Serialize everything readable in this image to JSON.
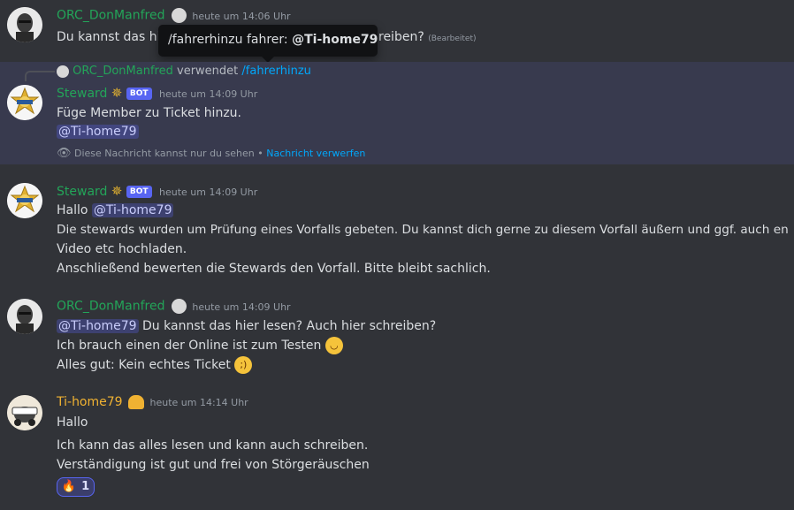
{
  "tooltip": {
    "command": "/fahrerhinzu fahrer:",
    "mention": "@Ti-home79"
  },
  "messages": {
    "m1": {
      "author": "ORC_DonManfred",
      "author_color": "#23a559",
      "timestamp": "heute um 14:06 Uhr",
      "line1_start": "Du kannst das hi",
      "line1_end": "reiben?",
      "edited": "(Bearbeitet)"
    },
    "m2": {
      "reply_user": "ORC_DonManfred",
      "reply_verb": "verwendet",
      "reply_command": "/fahrerhinzu",
      "author": "Steward",
      "bot_badge": "BOT",
      "timestamp": "heute um 14:09 Uhr",
      "line1": "Füge Member zu Ticket hinzu.",
      "mention": "@Ti-home79",
      "ephemeral_text": "Diese Nachricht kannst nur du sehen",
      "ephemeral_sep": "•",
      "dismiss_label": "Nachricht verwerfen"
    },
    "m3": {
      "author": "Steward",
      "bot_badge": "BOT",
      "timestamp": "heute um 14:09 Uhr",
      "greeting": "Hallo",
      "mention": "@Ti-home79",
      "line2": "Die stewards wurden um Prüfung eines Vorfalls gebeten. Du kannst dich gerne zu diesem Vorfall äußern und ggf. auch en",
      "line3": "Video etc hochladen.",
      "line4": "Anschließend bewerten die Stewards den Vorfall. Bitte bleibt sachlich."
    },
    "m4": {
      "author": "ORC_DonManfred",
      "timestamp": "heute um 14:09 Uhr",
      "mention": "@Ti-home79",
      "line1_rest": "Du kannst das hier lesen? Auch hier schreiben?",
      "line2": "Ich brauch einen der Online ist zum Testen",
      "line3": "Alles gut: Kein echtes Ticket"
    },
    "m5": {
      "author": "Ti-home79",
      "author_color": "#f0b232",
      "timestamp": "heute um 14:14 Uhr",
      "line1": "Hallo",
      "line2": "Ich kann das alles lesen und kann auch schreiben.",
      "line3": "Verständigung ist gut und frei von Störgeräuschen",
      "reaction_emoji": "🔥",
      "reaction_count": "1"
    }
  },
  "colors": {
    "background": "#313338",
    "highlight": "#383a4e",
    "mention_bg": "#3c4270",
    "link": "#00a8fc",
    "steward_green": "#23a559",
    "bot_badge": "#5865f2"
  }
}
